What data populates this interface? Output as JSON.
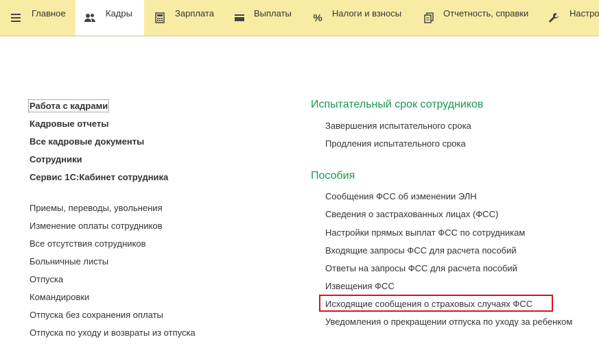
{
  "nav": {
    "tabs": [
      {
        "label": "Главное",
        "icon": "menu-lines-icon"
      },
      {
        "label": "Кадры",
        "icon": "users-icon"
      },
      {
        "label": "Зарплата",
        "icon": "calculator-icon"
      },
      {
        "label": "Выплаты",
        "icon": "wallet-icon"
      },
      {
        "label": "Налоги и взносы",
        "icon": "percent-icon"
      },
      {
        "label": "Отчетность, справки",
        "icon": "documents-icon"
      },
      {
        "label": "Настро",
        "icon": "wrench-icon"
      }
    ],
    "active_tab": "Кадры"
  },
  "left_column": {
    "bold_links": [
      "Работа с кадрами",
      "Кадровые отчеты",
      "Все кадровые документы",
      "Сотрудники",
      "Сервис 1С:Кабинет сотрудника"
    ],
    "links": [
      "Приемы, переводы, увольнения",
      "Изменение оплаты сотрудников",
      "Все отсутствия сотрудников",
      "Больничные листы",
      "Отпуска",
      "Командировки",
      "Отпуска без сохранения оплаты",
      "Отпуска по уходу и возвраты из отпуска"
    ]
  },
  "right_column": {
    "probation": {
      "title": "Испытательный срок сотрудников",
      "links": [
        "Завершения испытательного срока",
        "Продления испытательного срока"
      ]
    },
    "benefits": {
      "title": "Пособия",
      "links": [
        "Сообщения ФСС об изменении ЭЛН",
        "Сведения о застрахованных лицах (ФСС)",
        "Настройки прямых выплат ФСС по сотрудникам",
        "Входящие запросы ФСС для расчета пособий",
        "Ответы на запросы ФСС для расчета пособий",
        "Извещения ФСС",
        "Исходящие сообщения о страховых случаях ФСС",
        "Уведомления о прекращении отпуска по уходу за ребенком"
      ]
    }
  },
  "colors": {
    "topbar_bg": "#f8eca5",
    "section_title": "#1a9850",
    "highlight_border": "#e0101e"
  }
}
